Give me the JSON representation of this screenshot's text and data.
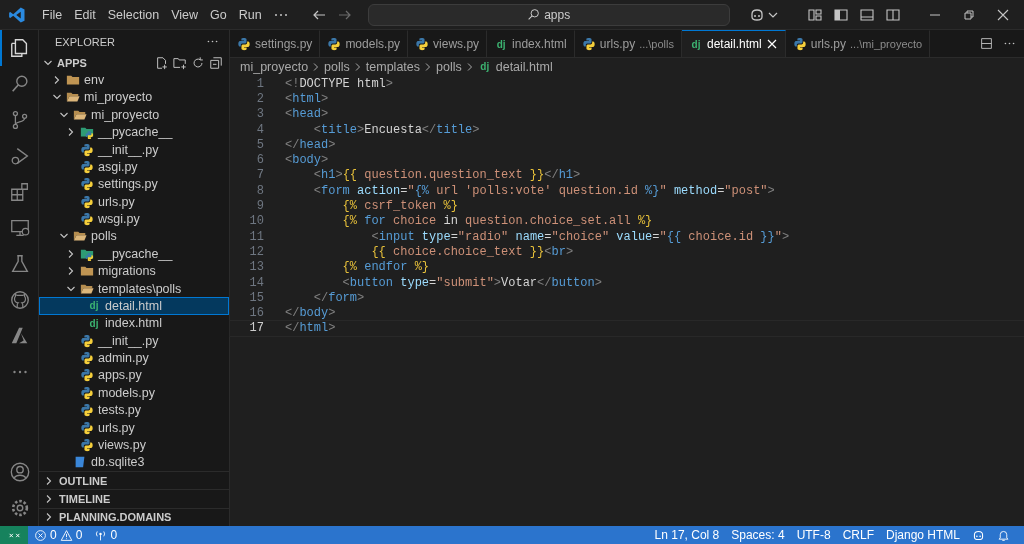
{
  "title_bar": {
    "menu": [
      "File",
      "Edit",
      "Selection",
      "View",
      "Go",
      "Run"
    ],
    "search": {
      "value": "apps"
    }
  },
  "activity_bar": {
    "items": [
      {
        "kind": "explorer",
        "selected": true
      },
      {
        "kind": "search",
        "selected": false
      },
      {
        "kind": "source-control",
        "selected": false
      },
      {
        "kind": "run-debug",
        "selected": false
      },
      {
        "kind": "extensions",
        "selected": false
      },
      {
        "kind": "remote",
        "selected": false
      },
      {
        "kind": "testing",
        "selected": false
      },
      {
        "kind": "github",
        "selected": false
      },
      {
        "kind": "azure",
        "selected": false
      },
      {
        "kind": "more",
        "selected": false
      }
    ],
    "bottom": [
      {
        "kind": "account"
      },
      {
        "kind": "settings"
      }
    ]
  },
  "sidebar": {
    "title": "EXPLORER",
    "section": {
      "label": "APPS",
      "expanded": true
    },
    "tree": [
      {
        "label": "env",
        "kind": "folder",
        "expanded": false,
        "selected": false
      },
      {
        "label": "mi_proyecto",
        "kind": "folder",
        "expanded": true,
        "selected": false,
        "children": [
          {
            "label": "mi_proyecto",
            "kind": "folder",
            "expanded": true,
            "selected": false,
            "children": [
              {
                "label": "__pycache__",
                "kind": "pycache",
                "expanded": false,
                "selected": false
              },
              {
                "label": "__init__.py",
                "kind": "python",
                "selected": false
              },
              {
                "label": "asgi.py",
                "kind": "python",
                "selected": false
              },
              {
                "label": "settings.py",
                "kind": "python",
                "selected": false
              },
              {
                "label": "urls.py",
                "kind": "python",
                "selected": false
              },
              {
                "label": "wsgi.py",
                "kind": "python",
                "selected": false
              }
            ]
          },
          {
            "label": "polls",
            "kind": "folder",
            "expanded": true,
            "selected": false,
            "children": [
              {
                "label": "__pycache__",
                "kind": "pycache",
                "expanded": false,
                "selected": false
              },
              {
                "label": "migrations",
                "kind": "folder",
                "expanded": false,
                "selected": false
              },
              {
                "label": "templates\\polls",
                "kind": "folder",
                "expanded": true,
                "selected": false,
                "children": [
                  {
                    "label": "detail.html",
                    "kind": "django",
                    "glyph": "dj",
                    "selected": true
                  },
                  {
                    "label": "index.html",
                    "kind": "django",
                    "glyph": "dj",
                    "selected": false
                  }
                ]
              },
              {
                "label": "__init__.py",
                "kind": "python",
                "selected": false
              },
              {
                "label": "admin.py",
                "kind": "python",
                "selected": false
              },
              {
                "label": "apps.py",
                "kind": "python",
                "selected": false
              },
              {
                "label": "models.py",
                "kind": "python",
                "selected": false
              },
              {
                "label": "tests.py",
                "kind": "python",
                "selected": false
              },
              {
                "label": "urls.py",
                "kind": "python",
                "selected": false
              },
              {
                "label": "views.py",
                "kind": "python",
                "selected": false
              }
            ]
          },
          {
            "label": "db.sqlite3",
            "kind": "sqlite",
            "selected": false
          }
        ]
      }
    ],
    "panels": [
      {
        "label": "OUTLINE",
        "expanded": false
      },
      {
        "label": "TIMELINE",
        "expanded": false
      },
      {
        "label": "PLANNING.DOMAINS",
        "expanded": false
      }
    ]
  },
  "editor": {
    "tabs": [
      {
        "label": "settings.py",
        "kind": "python",
        "selected": false
      },
      {
        "label": "models.py",
        "kind": "python",
        "selected": false
      },
      {
        "label": "views.py",
        "kind": "python",
        "selected": false
      },
      {
        "label": "index.html",
        "kind": "django",
        "glyph": "dj",
        "selected": false
      },
      {
        "label": "urls.py",
        "description": "...\\polls",
        "kind": "python",
        "selected": false
      },
      {
        "label": "detail.html",
        "kind": "django",
        "glyph": "dj",
        "selected": true
      },
      {
        "label": "urls.py",
        "description": "...\\mi_proyecto",
        "kind": "python",
        "selected": false
      }
    ],
    "breadcrumb": [
      {
        "label": "mi_proyecto"
      },
      {
        "label": "polls"
      },
      {
        "label": "templates"
      },
      {
        "label": "polls"
      },
      {
        "label": "detail.html",
        "kind": "django",
        "glyph": "dj"
      }
    ],
    "lines": [
      {
        "number": "1",
        "current": false,
        "tokens": [
          {
            "kind": "bracket",
            "text": "<!"
          },
          {
            "kind": "text",
            "text": "DOCTYPE html"
          },
          {
            "kind": "bracket",
            "text": ">"
          }
        ]
      },
      {
        "number": "2",
        "current": false,
        "tokens": [
          {
            "kind": "bracket",
            "text": "<"
          },
          {
            "kind": "tag",
            "text": "html"
          },
          {
            "kind": "bracket",
            "text": ">"
          }
        ]
      },
      {
        "number": "3",
        "current": false,
        "tokens": [
          {
            "kind": "bracket",
            "text": "<"
          },
          {
            "kind": "tag",
            "text": "head"
          },
          {
            "kind": "bracket",
            "text": ">"
          }
        ]
      },
      {
        "number": "4",
        "current": false,
        "tokens": [
          {
            "kind": "bracket",
            "text": "    <"
          },
          {
            "kind": "tag",
            "text": "title"
          },
          {
            "kind": "bracket",
            "text": ">"
          },
          {
            "kind": "text",
            "text": "Encuesta"
          },
          {
            "kind": "bracket",
            "text": "</"
          },
          {
            "kind": "tag",
            "text": "title"
          },
          {
            "kind": "bracket",
            "text": ">"
          }
        ]
      },
      {
        "number": "5",
        "current": false,
        "tokens": [
          {
            "kind": "bracket",
            "text": "</"
          },
          {
            "kind": "tag",
            "text": "head"
          },
          {
            "kind": "bracket",
            "text": ">"
          }
        ]
      },
      {
        "number": "6",
        "current": false,
        "tokens": [
          {
            "kind": "bracket",
            "text": "<"
          },
          {
            "kind": "tag",
            "text": "body"
          },
          {
            "kind": "bracket",
            "text": ">"
          }
        ]
      },
      {
        "number": "7",
        "current": false,
        "tokens": [
          {
            "kind": "bracket",
            "text": "    <"
          },
          {
            "kind": "tag",
            "text": "h1"
          },
          {
            "kind": "bracket",
            "text": ">"
          },
          {
            "kind": "tpl",
            "text": "{{"
          },
          {
            "kind": "var",
            "text": " question.question_text "
          },
          {
            "kind": "tpl",
            "text": "}}"
          },
          {
            "kind": "bracket",
            "text": "</"
          },
          {
            "kind": "tag",
            "text": "h1"
          },
          {
            "kind": "bracket",
            "text": ">"
          }
        ]
      },
      {
        "number": "8",
        "current": false,
        "tokens": [
          {
            "kind": "bracket",
            "text": "    <"
          },
          {
            "kind": "tag",
            "text": "form"
          },
          {
            "kind": "attr",
            "text": " action"
          },
          {
            "kind": "text",
            "text": "="
          },
          {
            "kind": "str",
            "text": "\""
          },
          {
            "kind": "kw",
            "text": "{%"
          },
          {
            "kind": "str",
            "text": " url 'polls:vote' question.id "
          },
          {
            "kind": "kw",
            "text": "%}"
          },
          {
            "kind": "str",
            "text": "\""
          },
          {
            "kind": "attr",
            "text": " method"
          },
          {
            "kind": "text",
            "text": "="
          },
          {
            "kind": "str",
            "text": "\"post\""
          },
          {
            "kind": "bracket",
            "text": ">"
          }
        ]
      },
      {
        "number": "9",
        "current": false,
        "tokens": [
          {
            "kind": "tpl",
            "text": "        {%"
          },
          {
            "kind": "var",
            "text": " csrf_token "
          },
          {
            "kind": "tpl",
            "text": "%}"
          }
        ]
      },
      {
        "number": "10",
        "current": false,
        "tokens": [
          {
            "kind": "tpl",
            "text": "        {%"
          },
          {
            "kind": "kw",
            "text": " for"
          },
          {
            "kind": "var",
            "text": " choice"
          },
          {
            "kind": "text",
            "text": " in"
          },
          {
            "kind": "var",
            "text": " question.choice_set.all "
          },
          {
            "kind": "tpl",
            "text": "%}"
          }
        ]
      },
      {
        "number": "11",
        "current": false,
        "tokens": [
          {
            "kind": "bracket",
            "text": "            <"
          },
          {
            "kind": "tag",
            "text": "input"
          },
          {
            "kind": "attr",
            "text": " type"
          },
          {
            "kind": "text",
            "text": "="
          },
          {
            "kind": "str",
            "text": "\"radio\""
          },
          {
            "kind": "attr",
            "text": " name"
          },
          {
            "kind": "text",
            "text": "="
          },
          {
            "kind": "str",
            "text": "\"choice\""
          },
          {
            "kind": "attr",
            "text": " value"
          },
          {
            "kind": "text",
            "text": "="
          },
          {
            "kind": "str",
            "text": "\""
          },
          {
            "kind": "kw",
            "text": "{{"
          },
          {
            "kind": "var",
            "text": " choice.id "
          },
          {
            "kind": "kw",
            "text": "}}"
          },
          {
            "kind": "str",
            "text": "\""
          },
          {
            "kind": "bracket",
            "text": ">"
          }
        ]
      },
      {
        "number": "12",
        "current": false,
        "tokens": [
          {
            "kind": "tpl",
            "text": "            {{"
          },
          {
            "kind": "var",
            "text": " choice.choice_text "
          },
          {
            "kind": "tpl",
            "text": "}}"
          },
          {
            "kind": "bracket",
            "text": "<"
          },
          {
            "kind": "tag",
            "text": "br"
          },
          {
            "kind": "bracket",
            "text": ">"
          }
        ]
      },
      {
        "number": "13",
        "current": false,
        "tokens": [
          {
            "kind": "tpl",
            "text": "        {%"
          },
          {
            "kind": "kw",
            "text": " endfor "
          },
          {
            "kind": "tpl",
            "text": "%}"
          }
        ]
      },
      {
        "number": "14",
        "current": false,
        "tokens": [
          {
            "kind": "bracket",
            "text": "        <"
          },
          {
            "kind": "tag",
            "text": "button"
          },
          {
            "kind": "attr",
            "text": " type"
          },
          {
            "kind": "text",
            "text": "="
          },
          {
            "kind": "str",
            "text": "\"submit\""
          },
          {
            "kind": "bracket",
            "text": ">"
          },
          {
            "kind": "text",
            "text": "Votar"
          },
          {
            "kind": "bracket",
            "text": "</"
          },
          {
            "kind": "tag",
            "text": "button"
          },
          {
            "kind": "bracket",
            "text": ">"
          }
        ]
      },
      {
        "number": "15",
        "current": false,
        "tokens": [
          {
            "kind": "bracket",
            "text": "    </"
          },
          {
            "kind": "tag",
            "text": "form"
          },
          {
            "kind": "bracket",
            "text": ">"
          }
        ]
      },
      {
        "number": "16",
        "current": false,
        "tokens": [
          {
            "kind": "bracket",
            "text": "</"
          },
          {
            "kind": "tag",
            "text": "body"
          },
          {
            "kind": "bracket",
            "text": ">"
          }
        ]
      },
      {
        "number": "17",
        "current": true,
        "tokens": [
          {
            "kind": "bracket",
            "text": "</"
          },
          {
            "kind": "tag",
            "text": "html"
          },
          {
            "kind": "bracket",
            "text": ">"
          }
        ]
      }
    ]
  },
  "status_bar": {
    "errors": "0",
    "warnings": "0",
    "ports": "0",
    "right": [
      "Ln 17, Col 8",
      "Spaces: 4",
      "UTF-8",
      "CRLF",
      "Django HTML"
    ]
  }
}
